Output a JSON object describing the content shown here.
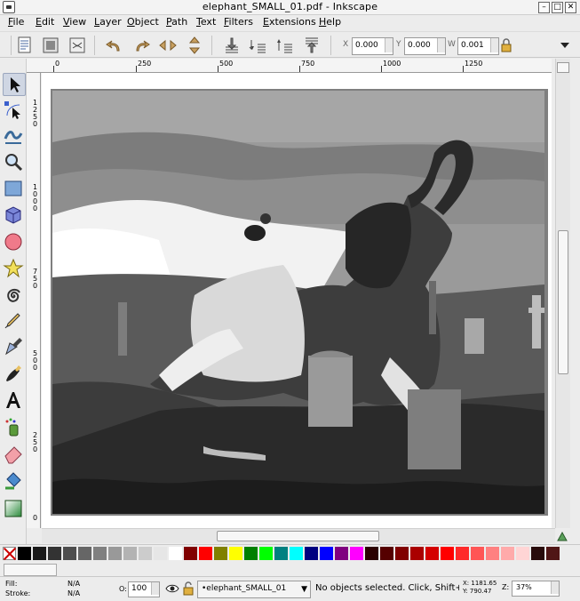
{
  "window": {
    "title": "elephant_SMALL_01.pdf - Inkscape"
  },
  "menu": [
    "File",
    "Edit",
    "View",
    "Layer",
    "Object",
    "Path",
    "Text",
    "Filters",
    "Extensions",
    "Help"
  ],
  "commands": {
    "tools": [
      "document-properties-icon",
      "align-icon",
      "xml-editor-icon",
      "undo-icon",
      "redo-icon",
      "flip-horizontal-icon",
      "flip-vertical-icon",
      "lower-to-bottom-icon",
      "lower-icon",
      "raise-icon",
      "raise-to-top-icon"
    ],
    "x_label": "X",
    "x_value": "0.000",
    "y_label": "Y",
    "y_value": "0.000",
    "w_label": "W",
    "w_value": "0.001",
    "lock": "lock-icon",
    "overflow": "menu-overflow-icon"
  },
  "ruler": {
    "h_labels": [
      "0",
      "250",
      "500",
      "750",
      "1000",
      "1250"
    ],
    "v_labels": [
      "1\n2\n5\n0",
      "1\n0\n0\n0",
      "7\n5\n0",
      "5\n0\n0",
      "2\n5\n0",
      "0"
    ]
  },
  "toolbox": [
    "selector-tool-icon",
    "node-tool-icon",
    "tweak-tool-icon",
    "zoom-tool-icon",
    "rectangle-tool-icon",
    "3d-box-tool-icon",
    "ellipse-tool-icon",
    "star-tool-icon",
    "spiral-tool-icon",
    "pencil-tool-icon",
    "pen-tool-icon",
    "calligraphy-tool-icon",
    "text-tool-icon",
    "spray-tool-icon",
    "eraser-tool-icon",
    "paint-bucket-tool-icon",
    "gradient-tool-icon"
  ],
  "palette": {
    "colors": [
      "#000000",
      "#1a1a1a",
      "#333333",
      "#4d4d4d",
      "#666666",
      "#808080",
      "#999999",
      "#b3b3b3",
      "#cccccc",
      "#e6e6e6",
      "#ffffff",
      "#800000",
      "#ff0000",
      "#808000",
      "#ffff00",
      "#008000",
      "#00ff00",
      "#008080",
      "#00ffff",
      "#000080",
      "#0000ff",
      "#800080",
      "#ff00ff",
      "#2b0000",
      "#550000",
      "#800000",
      "#aa0000",
      "#d40000",
      "#ff0000",
      "#ff2a2a",
      "#ff5555",
      "#ff8080",
      "#ffaaaa",
      "#ffd5d5",
      "#280b0b",
      "#501616"
    ]
  },
  "status": {
    "fill_label": "Fill:",
    "fill_value": "N/A",
    "stroke_label": "Stroke:",
    "stroke_value": "N/A",
    "opacity_label": "O:",
    "opacity_value": "100",
    "layer_name": "•elephant_SMALL_01",
    "message": "No objects selected. Click, Shift+",
    "x_coord": "X: 1181.65",
    "y_coord": "Y:  790.47",
    "zoom_label": "Z:",
    "zoom_value": "37%"
  }
}
